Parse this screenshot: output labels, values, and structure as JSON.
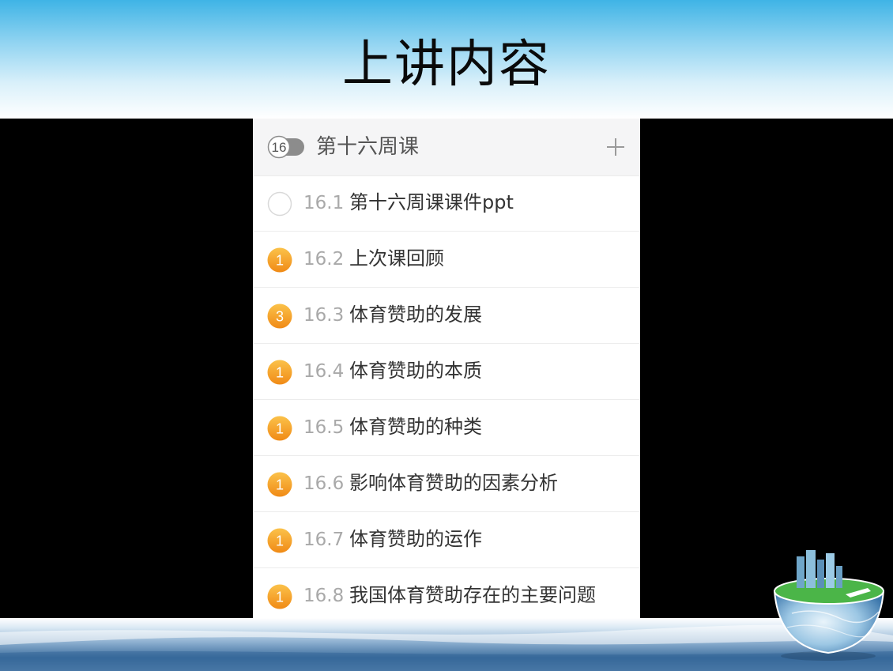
{
  "slide": {
    "title": "上讲内容"
  },
  "chapter": {
    "badge": "16",
    "title": "第十六周课",
    "add_label": "+"
  },
  "lessons": [
    {
      "num": "16.1",
      "title": "第十六周课课件ppt",
      "badge": ""
    },
    {
      "num": "16.2",
      "title": "上次课回顾",
      "badge": "1"
    },
    {
      "num": "16.3",
      "title": "体育赞助的发展",
      "badge": "3"
    },
    {
      "num": "16.4",
      "title": "体育赞助的本质",
      "badge": "1"
    },
    {
      "num": "16.5",
      "title": "体育赞助的种类",
      "badge": "1"
    },
    {
      "num": "16.6",
      "title": "影响体育赞助的因素分析",
      "badge": "1"
    },
    {
      "num": "16.7",
      "title": "体育赞助的运作",
      "badge": "1"
    },
    {
      "num": "16.8",
      "title": "我国体育赞助存在的主要问题",
      "badge": "1"
    }
  ],
  "colors": {
    "badge_orange": "#f39a1e",
    "badge_orange_light": "#fbc24a",
    "empty_circle": "#d9d9d9",
    "header_blue": "#3fb4e6"
  }
}
